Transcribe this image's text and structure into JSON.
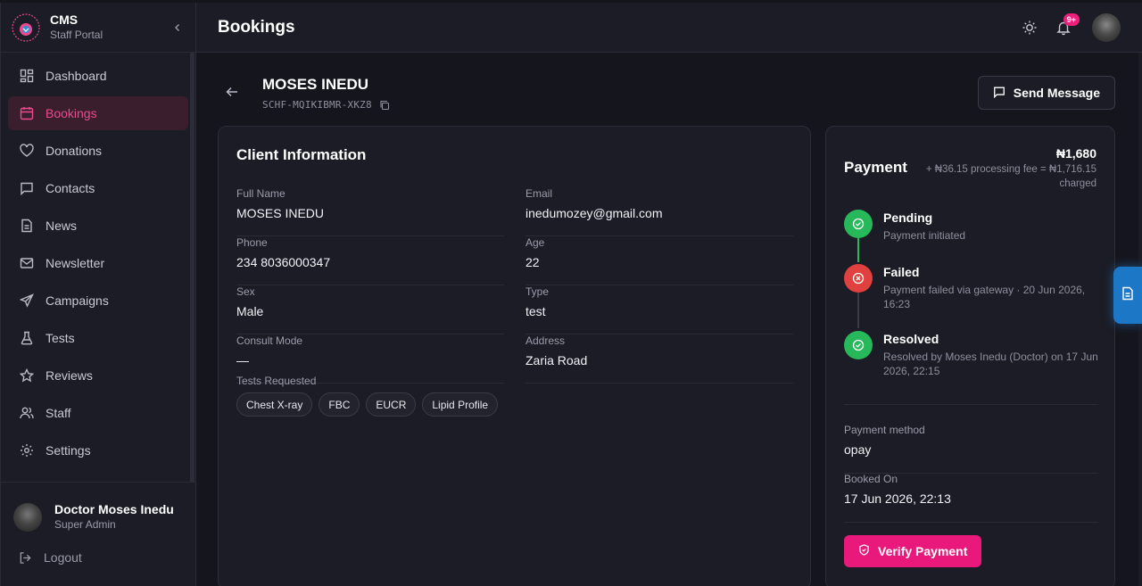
{
  "brand": {
    "title": "CMS",
    "subtitle": "Staff Portal"
  },
  "nav": {
    "items": [
      {
        "label": "Dashboard",
        "icon": "dashboard-icon"
      },
      {
        "label": "Bookings",
        "icon": "calendar-icon",
        "active": true
      },
      {
        "label": "Donations",
        "icon": "heart-icon"
      },
      {
        "label": "Contacts",
        "icon": "message-icon"
      },
      {
        "label": "News",
        "icon": "document-icon"
      },
      {
        "label": "Newsletter",
        "icon": "mail-icon"
      },
      {
        "label": "Campaigns",
        "icon": "send-icon"
      },
      {
        "label": "Tests",
        "icon": "flask-icon"
      },
      {
        "label": "Reviews",
        "icon": "star-icon"
      },
      {
        "label": "Staff",
        "icon": "users-icon"
      },
      {
        "label": "Settings",
        "icon": "gear-icon"
      }
    ]
  },
  "user": {
    "name": "Doctor Moses Inedu",
    "role": "Super Admin"
  },
  "logout_label": "Logout",
  "header": {
    "title": "Bookings",
    "notification_badge": "9+"
  },
  "booking": {
    "client_name": "MOSES INEDU",
    "reference": "SCHF-MQIKIBMR-XKZ8",
    "send_message_label": "Send Message"
  },
  "client_info": {
    "title": "Client Information",
    "fields": [
      {
        "label": "Full Name",
        "value": "MOSES INEDU"
      },
      {
        "label": "Email",
        "value": "inedumozey@gmail.com"
      },
      {
        "label": "Phone",
        "value": "234 8036000347"
      },
      {
        "label": "Age",
        "value": "22"
      },
      {
        "label": "Sex",
        "value": "Male"
      },
      {
        "label": "Type",
        "value": "test"
      },
      {
        "label": "Consult Mode",
        "value": "—"
      },
      {
        "label": "Address",
        "value": "Zaria Road"
      }
    ],
    "tests_label": "Tests Requested",
    "tests": [
      "Chest X-ray",
      "FBC",
      "EUCR",
      "Lipid Profile"
    ]
  },
  "payment": {
    "title": "Payment",
    "amount": "₦1,680",
    "fee_note": "+ ₦36.15 processing fee = ₦1,716.15 charged",
    "timeline": [
      {
        "title": "Pending",
        "desc": "Payment initiated",
        "status": "success"
      },
      {
        "title": "Failed",
        "desc": "Payment failed via gateway · 20 Jun 2026, 16:23",
        "status": "error"
      },
      {
        "title": "Resolved",
        "desc": "Resolved by Moses Inedu (Doctor) on 17 Jun 2026, 22:15",
        "status": "success"
      }
    ],
    "method_label": "Payment method",
    "method_value": "opay",
    "booked_label": "Booked On",
    "booked_value": "17 Jun 2026, 22:13",
    "verify_label": "Verify Payment"
  },
  "colors": {
    "accent": "#ec4a8f",
    "button": "#e8197b",
    "success": "#27b85a",
    "error": "#e0413e"
  }
}
